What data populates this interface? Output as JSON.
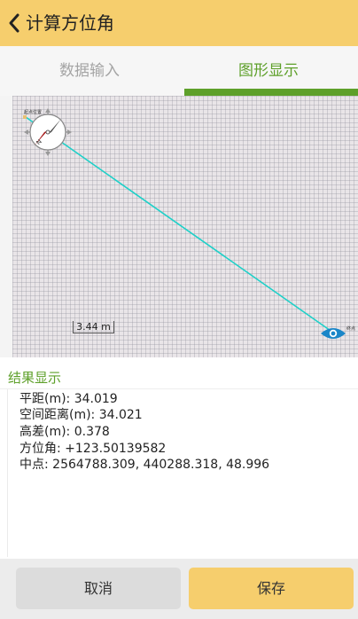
{
  "header": {
    "title": "计算方位角"
  },
  "tabs": [
    {
      "label": "数据输入",
      "active": false
    },
    {
      "label": "图形显示",
      "active": true
    }
  ],
  "plot": {
    "start_label": "起点位置",
    "end_label": "终点",
    "scale_label": "3.44 m",
    "line_color": "#1dd0c8",
    "compass_north_letter": "N"
  },
  "results": {
    "heading": "结果显示",
    "lines": [
      "平距(m): 34.019",
      "空间距离(m): 34.021",
      "高差(m): 0.378",
      "方位角: +123.50139582",
      "中点: 2564788.309, 440288.318, 48.996"
    ]
  },
  "footer": {
    "cancel_label": "取消",
    "save_label": "保存"
  },
  "colors": {
    "accent": "#f6ce6d",
    "green": "#5ea02a",
    "eye_blue": "#1a86c8"
  }
}
